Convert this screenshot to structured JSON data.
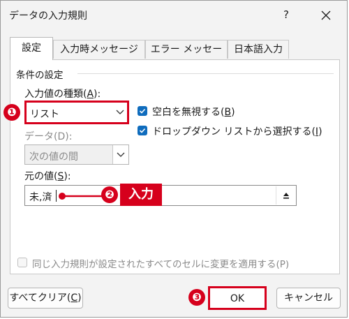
{
  "window": {
    "title": "データの入力規則",
    "help_label": "?",
    "close_icon": "close-icon"
  },
  "tabs": [
    {
      "label": "設定",
      "active": true
    },
    {
      "label": "入力時メッセージ",
      "active": false
    },
    {
      "label": "エラー メッセージ",
      "active": false
    },
    {
      "label": "日本語入力",
      "active": false
    }
  ],
  "settings": {
    "group_title": "条件の設定",
    "allow_label": "入力値の種類(A):",
    "allow_label_pre": "入力値の種類(",
    "allow_label_key": "A",
    "allow_label_post": "):",
    "allow_value": "リスト",
    "data_label": "データ(D):",
    "data_value": "次の値の間",
    "ignore_blank_label_pre": "空白を無視する(",
    "ignore_blank_key": "B",
    "ignore_blank_label_post": ")",
    "ignore_blank_checked": true,
    "dropdown_label_pre": "ドロップダウン リストから選択する(",
    "dropdown_key": "I",
    "dropdown_label_post": ")",
    "dropdown_checked": true,
    "source_label_pre": "元の値(",
    "source_key": "S",
    "source_label_post": "):",
    "source_value": "未,済",
    "apply_all_label": "同じ入力規則が設定されたすべてのセルに変更を適用する(P)",
    "apply_all_checked": false
  },
  "annotations": {
    "badge1": "❶",
    "badge2": "❷",
    "badge3": "❸",
    "callout_label": "入力",
    "accent_color": "#d6001c"
  },
  "buttons": {
    "clear_pre": "すべてクリア(",
    "clear_key": "C",
    "clear_post": ")",
    "ok": "OK",
    "cancel": "キャンセル"
  }
}
